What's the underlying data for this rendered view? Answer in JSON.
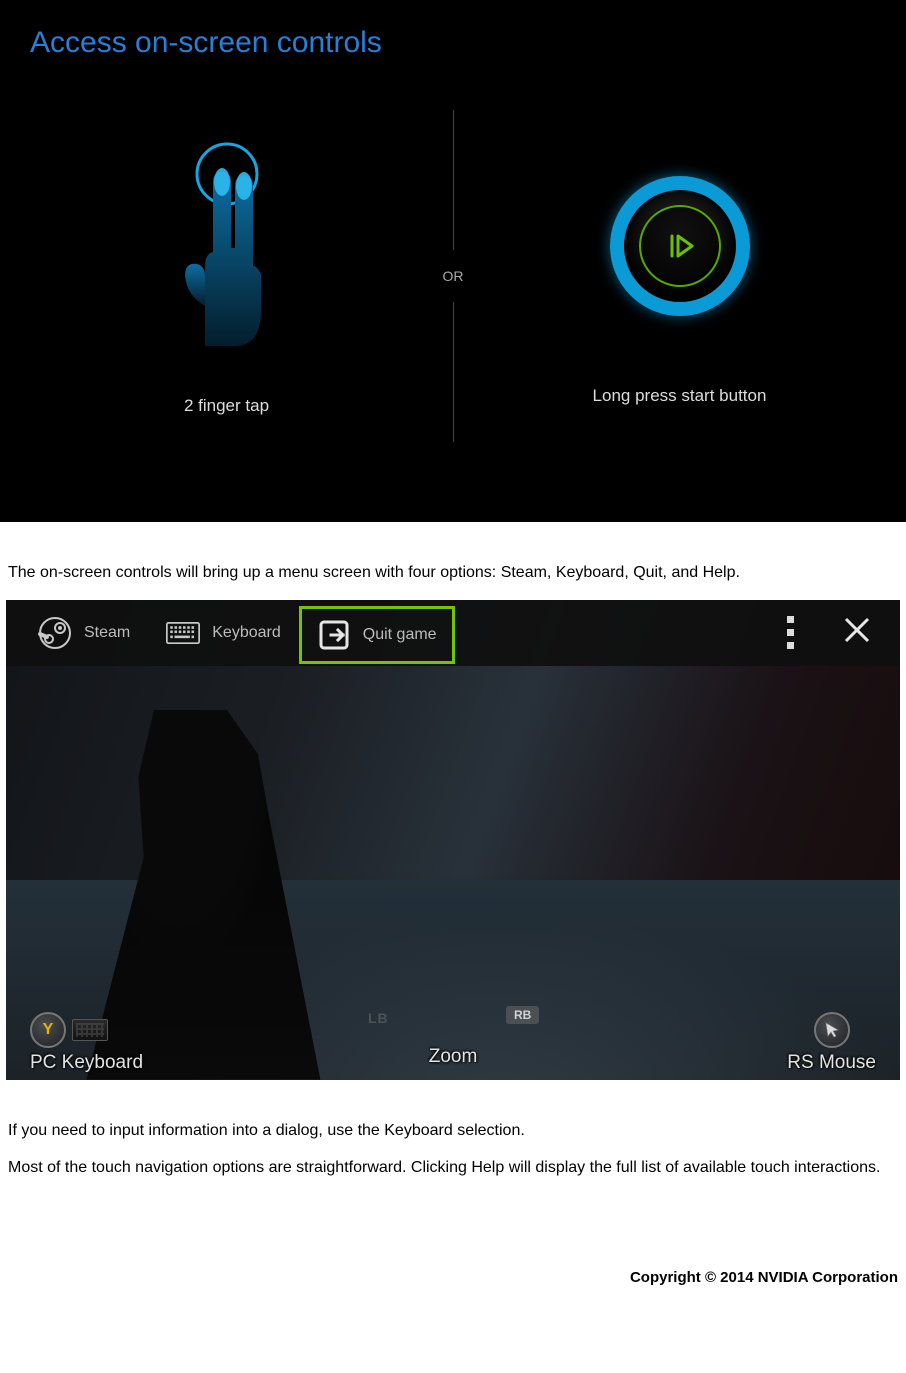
{
  "panel1": {
    "title": "Access on-screen controls",
    "or_label": "OR",
    "left_caption": "2 finger tap",
    "right_caption": "Long press start button"
  },
  "body_text": {
    "p1": "The on-screen controls will bring up a menu screen with four options: Steam, Keyboard, Quit, and Help.",
    "p2": "If you need to input information into a dialog, use the Keyboard selection.",
    "p3": "Most of the touch navigation options are straightforward. Clicking Help will display the full list of available touch interactions."
  },
  "overlay": {
    "items": [
      {
        "label": "Steam",
        "icon": "steam-icon",
        "selected": false
      },
      {
        "label": "Keyboard",
        "icon": "keyboard-icon",
        "selected": false
      },
      {
        "label": "Quit game",
        "icon": "exit-icon",
        "selected": true
      }
    ],
    "badges": {
      "lb": "LB",
      "rb": "RB"
    }
  },
  "hud": {
    "left_label": "PC Keyboard",
    "center_label": "Zoom",
    "right_label": "RS Mouse",
    "y_button_letter": "Y"
  },
  "footer": {
    "copyright": "Copyright © 2014 NVIDIA Corporation"
  }
}
